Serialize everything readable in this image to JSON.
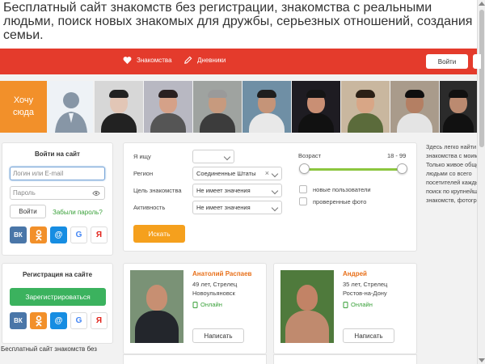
{
  "headline": "Бесплатный сайт знакомств без регистрации, знакомства с реальными людьми, поиск новых знакомых для дружбы, серьезных отношений, создания семьи.",
  "nav": {
    "items": [
      {
        "label": "Знакомства",
        "icon": "heart-icon"
      },
      {
        "label": "Дневники",
        "icon": "pencil-icon"
      }
    ],
    "login_label": "Войти"
  },
  "photo_strip": {
    "cta_line1": "Хочу",
    "cta_line2": "сюда"
  },
  "login_box": {
    "title": "Войти на сайт",
    "login_placeholder": "Логин или E-mail",
    "password_placeholder": "Пароль",
    "submit_label": "Войти",
    "forgot_label": "Забыли пароль?",
    "socials": [
      "ВК",
      "ok",
      "@",
      "G",
      "Я"
    ]
  },
  "register_box": {
    "title": "Регистрация на сайте",
    "button_label": "Зарегистрироваться",
    "socials": [
      "ВК",
      "ok",
      "@",
      "G",
      "Я"
    ]
  },
  "footer_text": "Бесплатный сайт знакомств без",
  "search": {
    "looking_label": "Я ищу",
    "looking_value": "",
    "region_label": "Регион",
    "region_value": "Соединенные Штаты",
    "goal_label": "Цель знакомства",
    "goal_value": "Не имеет значения",
    "activity_label": "Активность",
    "activity_value": "Не имеет значения",
    "submit_label": "Искать",
    "age_label": "Возраст",
    "age_range": "18 - 99",
    "age_min": 18,
    "age_max": 99,
    "new_users_label": "новые пользователи",
    "verified_photo_label": "проверенные фото"
  },
  "side_text": [
    "Здесь легко найти",
    "знакомства с моим",
    "Только живое общение",
    "людьми со всего",
    "посетителей каждый",
    "поиск по крупнейшей",
    "знакомств, фотографий"
  ],
  "profiles": [
    {
      "name": "Анатолий Распаев",
      "age_sign": "49 лет, Стрелец",
      "city": "Новоульяновск",
      "status": "Онлайн",
      "write_label": "Написать"
    },
    {
      "name": "Андрей",
      "age_sign": "35 лет, Стрелец",
      "city": "Ростов-на-Дону",
      "status": "Онлайн",
      "write_label": "Написать"
    }
  ],
  "colors": {
    "brand_red": "#e43b2c",
    "accent_orange": "#f2902a",
    "search_orange": "#f5a01d",
    "register_green": "#3bb25e",
    "online_green": "#3aa13a",
    "name_orange": "#e8701a"
  }
}
